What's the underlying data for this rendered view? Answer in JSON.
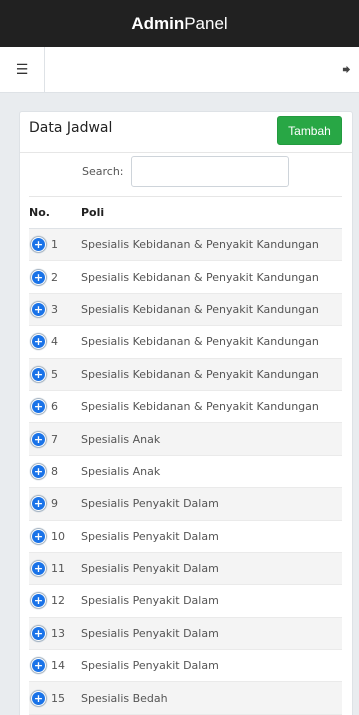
{
  "brand": {
    "strong": "Admin",
    "light": "Panel"
  },
  "nav": {
    "menu_icon": "hamburger-icon",
    "logout_icon": "logout-icon"
  },
  "card": {
    "title": "Data Jadwal",
    "add_button": "Tambah",
    "search_label": "Search:",
    "search_value": ""
  },
  "table": {
    "headers": {
      "no": "No.",
      "poli": "Poli"
    },
    "rows": [
      {
        "no": "1",
        "poli": "Spesialis Kebidanan & Penyakit Kandungan"
      },
      {
        "no": "2",
        "poli": "Spesialis Kebidanan & Penyakit Kandungan"
      },
      {
        "no": "3",
        "poli": "Spesialis Kebidanan & Penyakit Kandungan"
      },
      {
        "no": "4",
        "poli": "Spesialis Kebidanan & Penyakit Kandungan"
      },
      {
        "no": "5",
        "poli": "Spesialis Kebidanan & Penyakit Kandungan"
      },
      {
        "no": "6",
        "poli": "Spesialis Kebidanan & Penyakit Kandungan"
      },
      {
        "no": "7",
        "poli": "Spesialis Anak"
      },
      {
        "no": "8",
        "poli": "Spesialis Anak"
      },
      {
        "no": "9",
        "poli": "Spesialis Penyakit Dalam"
      },
      {
        "no": "10",
        "poli": "Spesialis Penyakit Dalam"
      },
      {
        "no": "11",
        "poli": "Spesialis Penyakit Dalam"
      },
      {
        "no": "12",
        "poli": "Spesialis Penyakit Dalam"
      },
      {
        "no": "13",
        "poli": "Spesialis Penyakit Dalam"
      },
      {
        "no": "14",
        "poli": "Spesialis Penyakit Dalam"
      },
      {
        "no": "15",
        "poli": "Spesialis Bedah"
      },
      {
        "no": "",
        "poli": ""
      }
    ]
  },
  "colors": {
    "header_bg": "#212121",
    "accent_green": "#28a745",
    "expand_blue": "#1a73e8"
  }
}
